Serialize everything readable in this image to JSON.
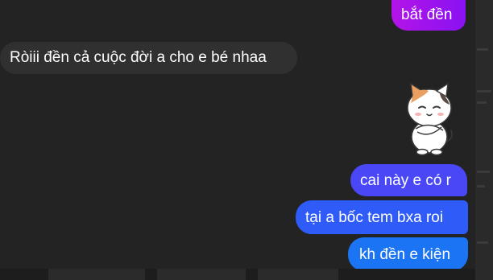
{
  "messages": {
    "top_sent": "bắt đền",
    "incoming": "Ròiii đền cả cuộc đời a cho e bé nhaa",
    "sent_1": "cai này e có r",
    "sent_2": "tại a bốc tem bxa roi",
    "sent_3": "kh đền e kiện"
  },
  "sticker": {
    "icon": "cat-sticker-icon"
  },
  "colors": {
    "background": "#232323",
    "incoming_bubble": "#303030",
    "sent_bubble_purple": "#8a12f2",
    "sent_bubble_indigo": "#4a48f6",
    "sent_bubble_blue": "#2f5cf8",
    "sent_bubble_light_blue": "#1a74f4"
  }
}
